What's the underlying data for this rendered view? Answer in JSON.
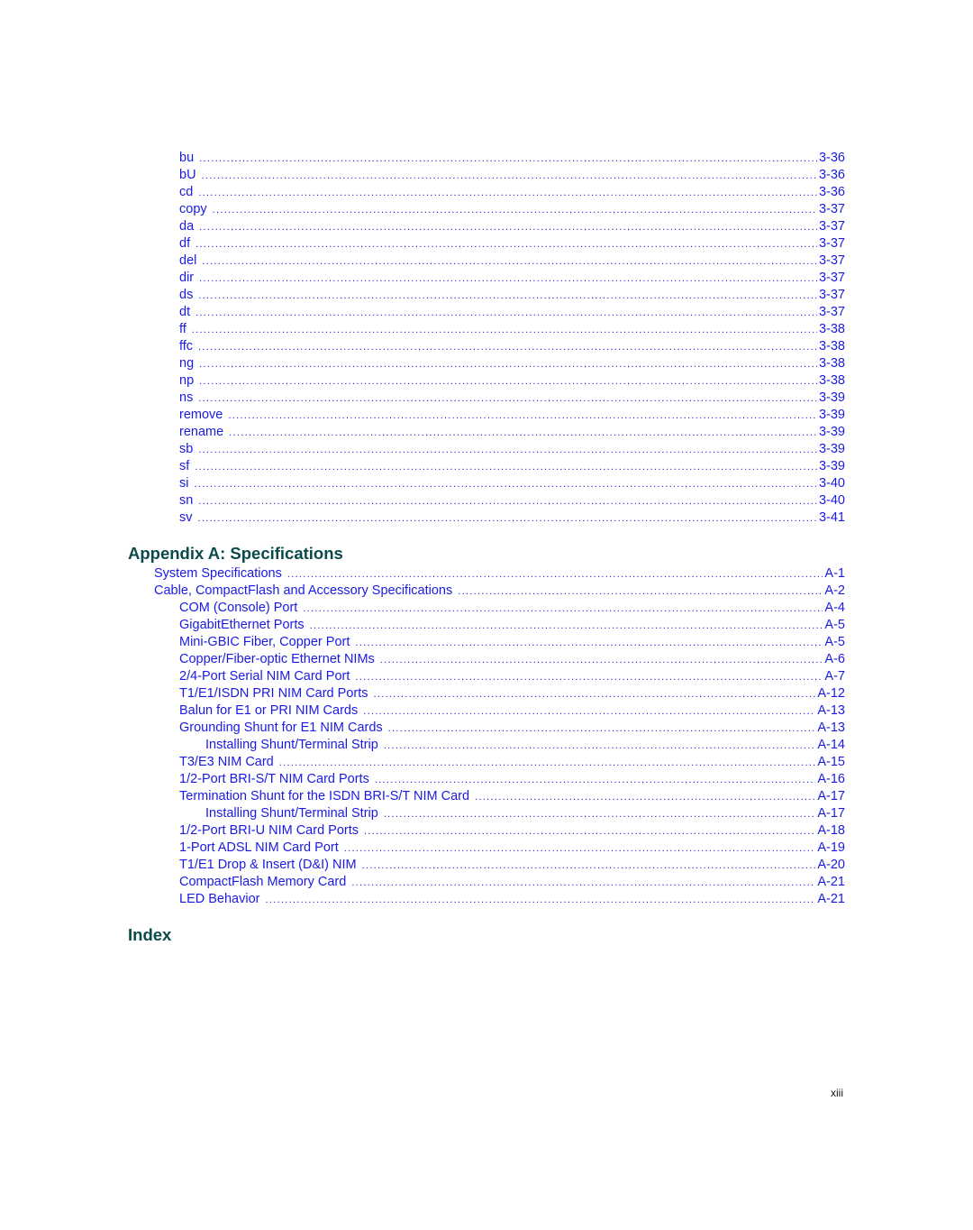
{
  "commands": [
    {
      "label": "bu",
      "page": "3-36"
    },
    {
      "label": "bU",
      "page": "3-36"
    },
    {
      "label": "cd",
      "page": "3-36"
    },
    {
      "label": "copy",
      "page": "3-37"
    },
    {
      "label": "da",
      "page": "3-37"
    },
    {
      "label": "df",
      "page": "3-37"
    },
    {
      "label": "del",
      "page": "3-37"
    },
    {
      "label": "dir",
      "page": "3-37"
    },
    {
      "label": "ds",
      "page": "3-37"
    },
    {
      "label": "dt",
      "page": "3-37"
    },
    {
      "label": "ff",
      "page": "3-38"
    },
    {
      "label": "ffc",
      "page": "3-38"
    },
    {
      "label": "ng",
      "page": "3-38"
    },
    {
      "label": "np",
      "page": "3-38"
    },
    {
      "label": "ns",
      "page": "3-39"
    },
    {
      "label": "remove",
      "page": "3-39"
    },
    {
      "label": "rename",
      "page": "3-39"
    },
    {
      "label": "sb",
      "page": "3-39"
    },
    {
      "label": "sf",
      "page": "3-39"
    },
    {
      "label": "si",
      "page": "3-40"
    },
    {
      "label": "sn",
      "page": "3-40"
    },
    {
      "label": "sv",
      "page": "3-41"
    }
  ],
  "appendix": {
    "title": "Appendix A: Specifications",
    "entries": [
      {
        "label": "System Specifications",
        "page": "A-1",
        "level": 1
      },
      {
        "label": "Cable, CompactFlash and Accessory Specifications",
        "page": "A-2",
        "level": 1
      },
      {
        "label": "COM (Console) Port",
        "page": "A-4",
        "level": 2
      },
      {
        "label": "GigabitEthernet Ports",
        "page": "A-5",
        "level": 2
      },
      {
        "label": "Mini-GBIC Fiber, Copper Port",
        "page": "A-5",
        "level": 2
      },
      {
        "label": "Copper/Fiber-optic Ethernet NIMs",
        "page": "A-6",
        "level": 2
      },
      {
        "label": "2/4-Port Serial NIM Card Port",
        "page": "A-7",
        "level": 2
      },
      {
        "label": "T1/E1/ISDN PRI NIM Card Ports",
        "page": "A-12",
        "level": 2
      },
      {
        "label": "Balun for E1 or PRI NIM Cards",
        "page": "A-13",
        "level": 2
      },
      {
        "label": "Grounding Shunt for E1 NIM Cards",
        "page": "A-13",
        "level": 2
      },
      {
        "label": "Installing Shunt/Terminal Strip",
        "page": "A-14",
        "level": 3
      },
      {
        "label": "T3/E3 NIM Card",
        "page": "A-15",
        "level": 2
      },
      {
        "label": "1/2-Port BRI-S/T NIM Card Ports",
        "page": "A-16",
        "level": 2
      },
      {
        "label": "Termination Shunt for the ISDN BRI-S/T NIM Card",
        "page": "A-17",
        "level": 2
      },
      {
        "label": "Installing Shunt/Terminal Strip",
        "page": "A-17",
        "level": 3
      },
      {
        "label": "1/2-Port BRI-U NIM Card Ports",
        "page": "A-18",
        "level": 2
      },
      {
        "label": "1-Port ADSL NIM Card Port",
        "page": "A-19",
        "level": 2
      },
      {
        "label": "T1/E1 Drop & Insert (D&I) NIM",
        "page": "A-20",
        "level": 2
      },
      {
        "label": "CompactFlash Memory Card",
        "page": "A-21",
        "level": 2
      },
      {
        "label": "LED Behavior",
        "page": "A-21",
        "level": 2
      }
    ]
  },
  "index": {
    "title": "Index"
  },
  "footer": {
    "page_number": "xiii"
  },
  "colors": {
    "link": "#1a1ae6",
    "heading": "#0b4a4a"
  }
}
